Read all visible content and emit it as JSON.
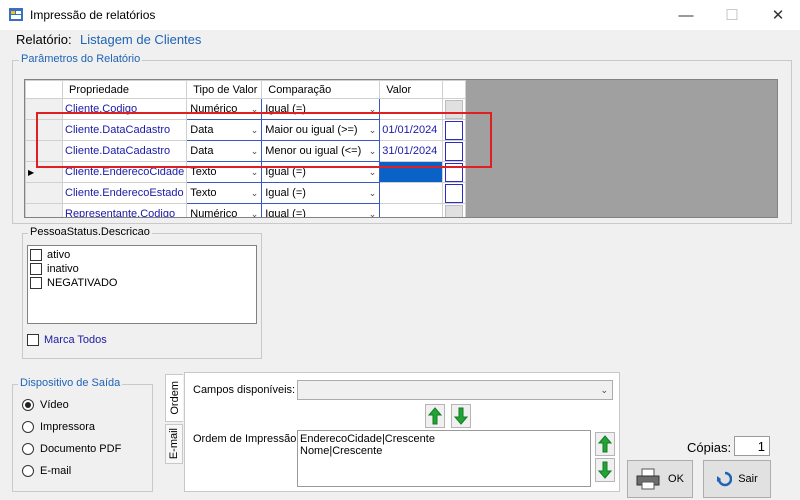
{
  "window": {
    "title": "Impressão de relatórios",
    "minimize": "—",
    "maximize": "☐",
    "close": "✕"
  },
  "report": {
    "label": "Relatório:",
    "value": "Listagem de Clientes"
  },
  "params": {
    "legend": "Parâmetros do Relatório",
    "columns": [
      "Propriedade",
      "Tipo de Valor",
      "Comparação",
      "Valor"
    ],
    "rows": [
      {
        "prop": "Cliente.Codigo",
        "tipo": "Numérico",
        "comp": "Igual (=)",
        "valor": ""
      },
      {
        "prop": "Cliente.DataCadastro",
        "tipo": "Data",
        "comp": "Maior ou igual (>=)",
        "valor": "01/01/2024"
      },
      {
        "prop": "Cliente.DataCadastro",
        "tipo": "Data",
        "comp": "Menor ou igual (<=)",
        "valor": "31/01/2024"
      },
      {
        "prop": "Cliente.EnderecoCidade",
        "tipo": "Texto",
        "comp": "Igual (=)",
        "valor": ""
      },
      {
        "prop": "Cliente.EnderecoEstado",
        "tipo": "Texto",
        "comp": "Igual (=)",
        "valor": ""
      },
      {
        "prop": "Representante.Codigo",
        "tipo": "Numérico",
        "comp": "Igual (=)",
        "valor": ""
      }
    ]
  },
  "status": {
    "legend": "PessoaStatus.Descricao",
    "items": [
      "ativo",
      "inativo",
      "NEGATIVADO"
    ],
    "mark_all": "Marca Todos"
  },
  "output": {
    "legend": "Dispositivo de Saída",
    "options": [
      "Vídeo",
      "Impressora",
      "Documento PDF",
      "E-mail"
    ],
    "selected": "Vídeo"
  },
  "tabs": {
    "ordem": "Ordem",
    "email": "E-mail"
  },
  "ordem": {
    "campos_label": "Campos disponíveis:",
    "campos_value": "",
    "ordem_label": "Ordem de Impressão:",
    "ordem_items": [
      "EnderecoCidade|Crescente",
      "Nome|Crescente"
    ]
  },
  "copies": {
    "label": "Cópias:",
    "value": "1"
  },
  "buttons": {
    "ok": "OK",
    "sair": "Sair"
  },
  "colors": {
    "link_blue": "#1e63b5",
    "highlight_red": "#e02020",
    "selection": "#0a62c7",
    "arrow_green": "#21a635"
  }
}
